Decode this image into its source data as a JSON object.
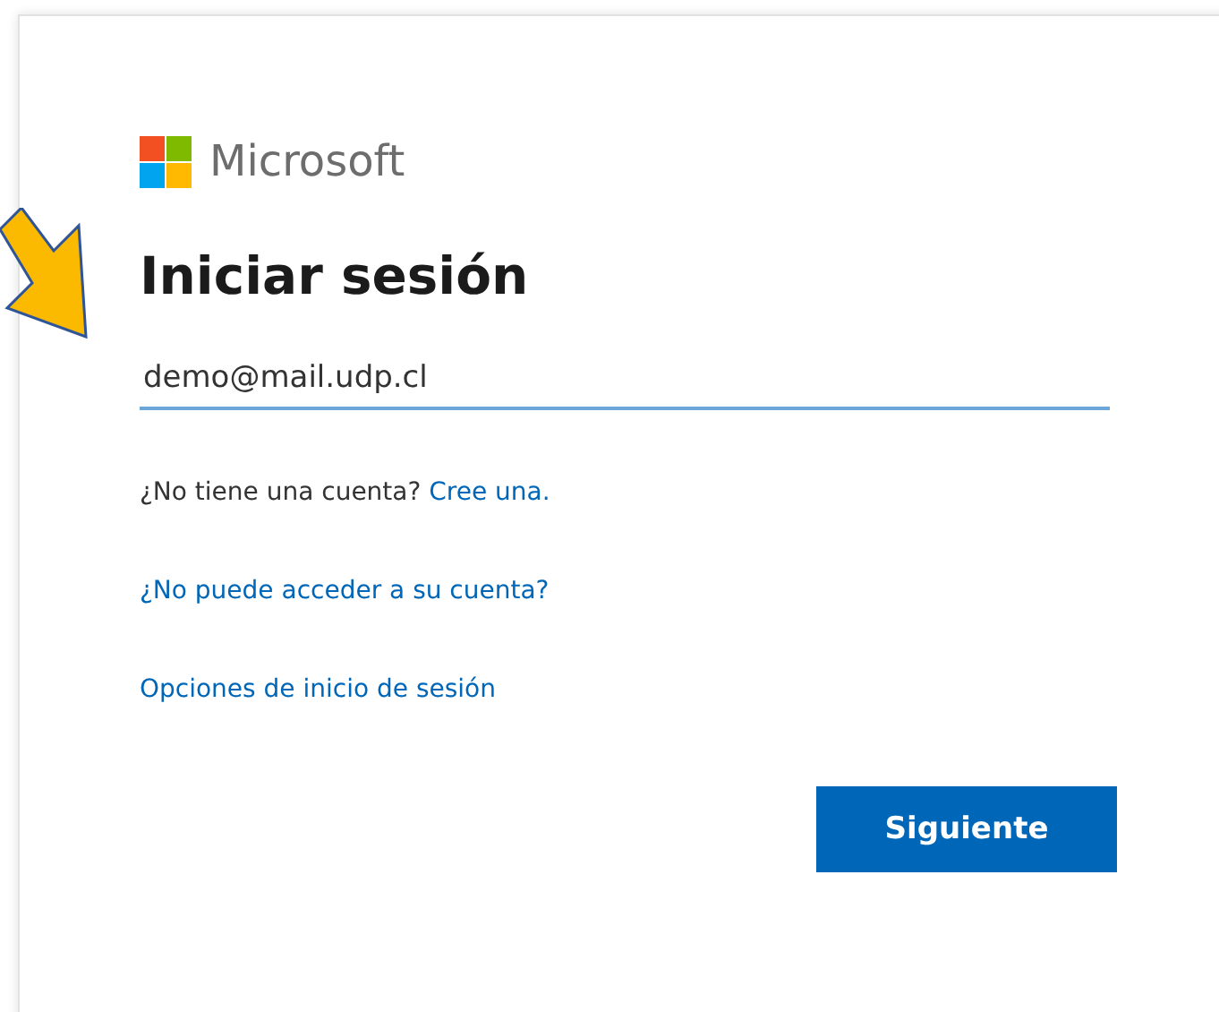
{
  "logo": {
    "text": "Microsoft"
  },
  "title": "Iniciar sesión",
  "email_field": {
    "value": "demo@mail.udp.cl",
    "focused": true
  },
  "signup_prompt": {
    "text": "¿No tiene una cuenta?",
    "link": "Cree una."
  },
  "links": [
    "¿No puede acceder a su cuenta?",
    "Opciones de inicio de sesión"
  ],
  "buttons": [
    {
      "label": "Siguiente"
    }
  ]
}
